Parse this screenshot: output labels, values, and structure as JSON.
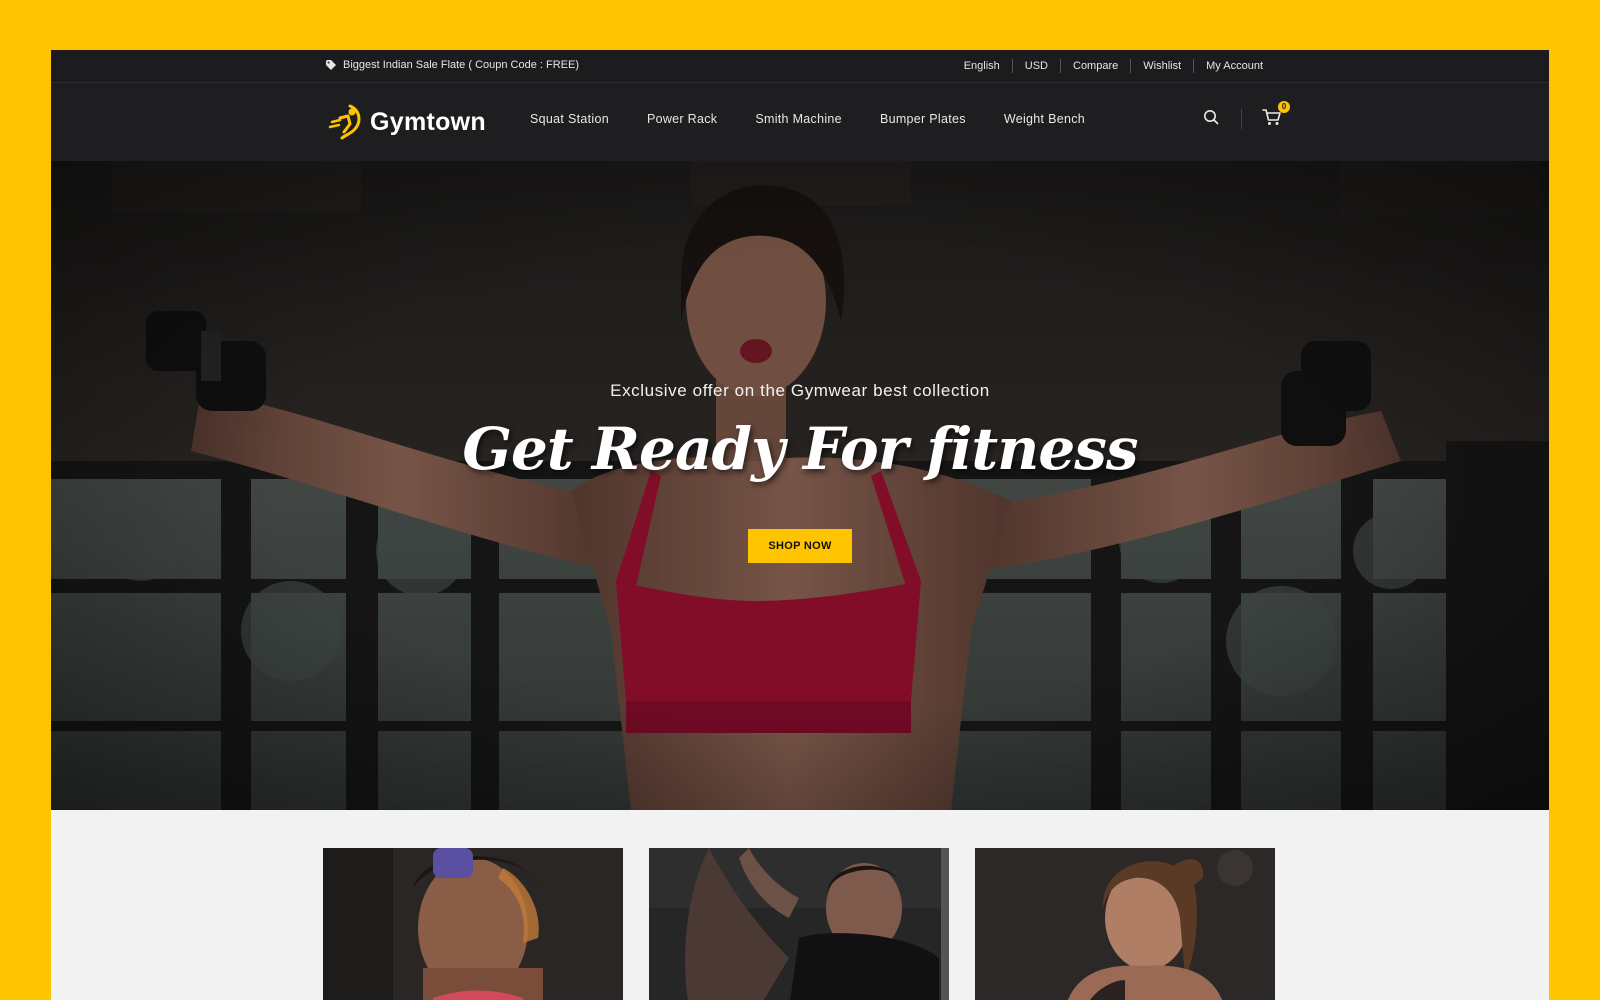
{
  "topbar": {
    "promo": "Biggest Indian Sale Flate ( Coupn Code : FREE)",
    "links": [
      "English",
      "USD",
      "Compare",
      "Wishlist",
      "My Account"
    ]
  },
  "header": {
    "logo_text": "Gymtown",
    "nav": [
      "Squat Station",
      "Power Rack",
      "Smith Machine",
      "Bumper Plates",
      "Weight Bench"
    ],
    "cart_count": "0"
  },
  "hero": {
    "subtitle": "Exclusive offer on the Gymwear best collection",
    "title": "Get Ready For fitness",
    "button": "SHOP NOW"
  },
  "icons": {
    "tag": "tag-icon",
    "search": "search-icon",
    "cart": "cart-icon",
    "logo": "runner-logo-icon"
  },
  "colors": {
    "accent": "#FFC400",
    "dark": "#1e1e20",
    "topbar": "#1c1c1e",
    "page": "#f2f2f2"
  }
}
